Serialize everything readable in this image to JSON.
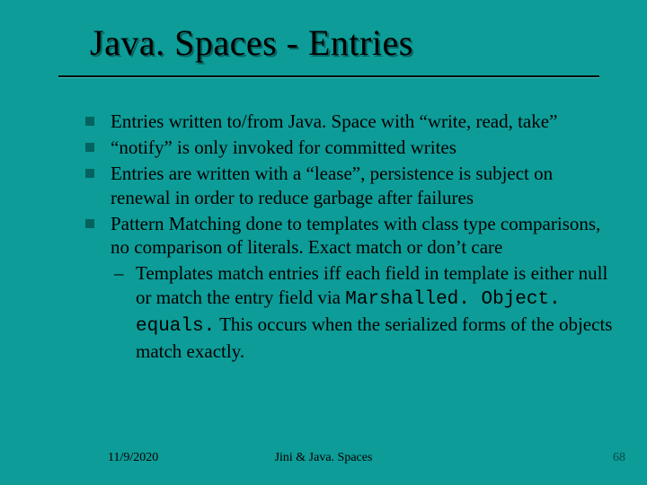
{
  "title": "Java. Spaces - Entries",
  "bullets": [
    "Entries written to/from Java. Space with “write, read, take”",
    "“notify” is only invoked for committed writes",
    "Entries are written with a “lease”, persistence is subject on renewal in order to reduce garbage after failures",
    "Pattern Matching done to templates with class type comparisons, no comparison of literals. Exact match or don’t care"
  ],
  "sub_prefix": "Templates match entries iff each field in template is either null or match the entry field via ",
  "sub_code": "Marshalled. Object. equals.",
  "sub_suffix": " This occurs when the serialized forms of the objects match exactly.",
  "footer": {
    "date": "11/9/2020",
    "center": "Jini  &  Java. Spaces",
    "page": "68"
  }
}
